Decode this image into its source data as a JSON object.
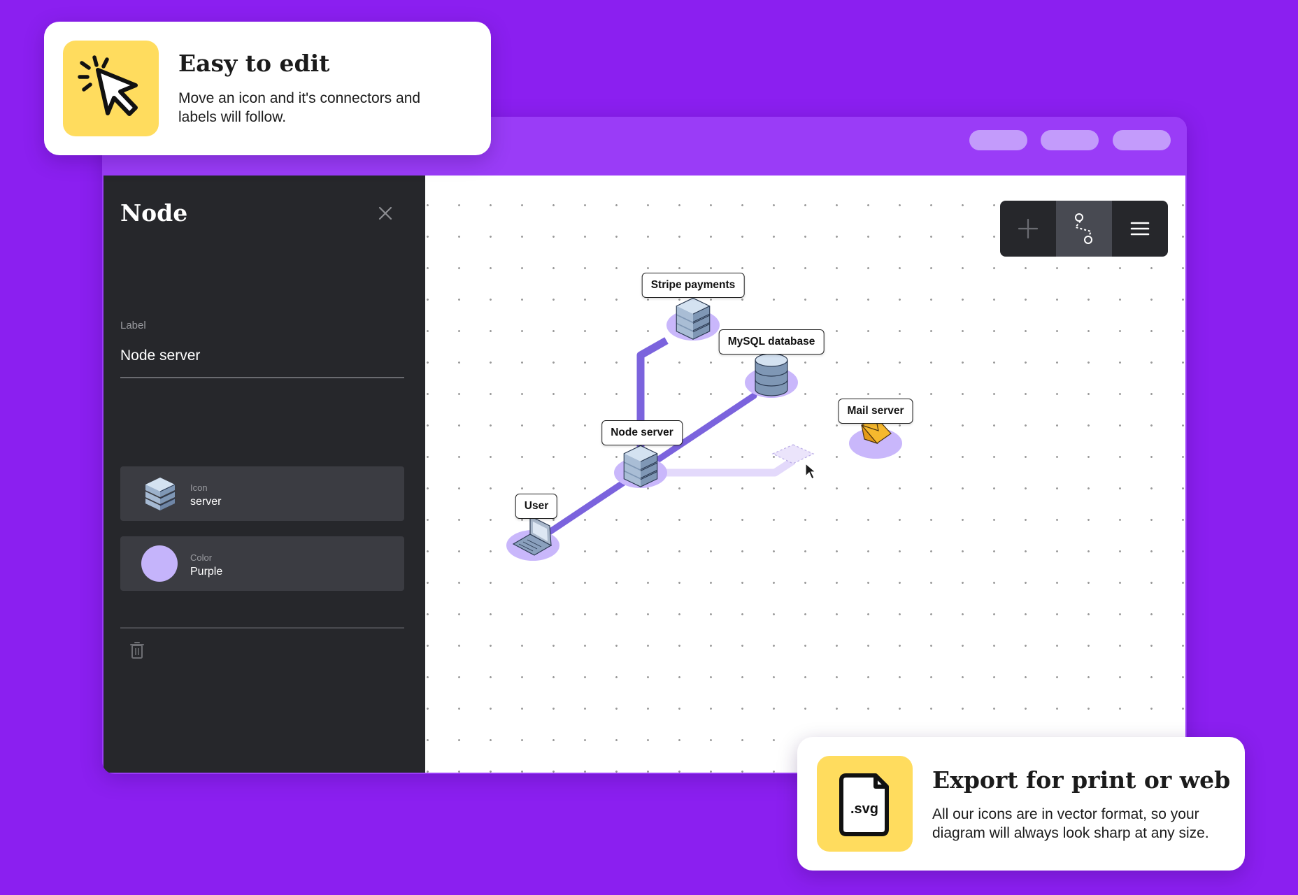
{
  "callouts": {
    "edit": {
      "title": "Easy to edit",
      "line1": "Move an icon and it's connectors and",
      "line2": "labels will follow.",
      "icon": "cursor-click-icon"
    },
    "export": {
      "title": "Export for print or web",
      "line1": "All our icons are in vector format, so your",
      "line2": "diagram will always look sharp at any size.",
      "icon_text": ".svg",
      "icon": "svg-file-icon"
    }
  },
  "panel": {
    "title": "Node",
    "label_caption": "Label",
    "label_value": "Node server",
    "icon_caption": "Icon",
    "icon_value": "server",
    "color_caption": "Color",
    "color_value": "Purple"
  },
  "toolbar": {
    "items": [
      "plus-icon",
      "connector-icon",
      "menu-icon"
    ],
    "active": "connector-icon"
  },
  "diagram": {
    "nodes": {
      "stripe": "Stripe payments",
      "mysql": "MySQL database",
      "mail": "Mail server",
      "node": "Node server",
      "user": "User"
    }
  },
  "colors": {
    "background": "#8b1ff0",
    "window_frame": "#9a3cf7",
    "panel_bg": "#26272b",
    "card_accent": "#ffdc5e",
    "connector": "#7b63dd",
    "node_base": "#c9b7fb"
  }
}
